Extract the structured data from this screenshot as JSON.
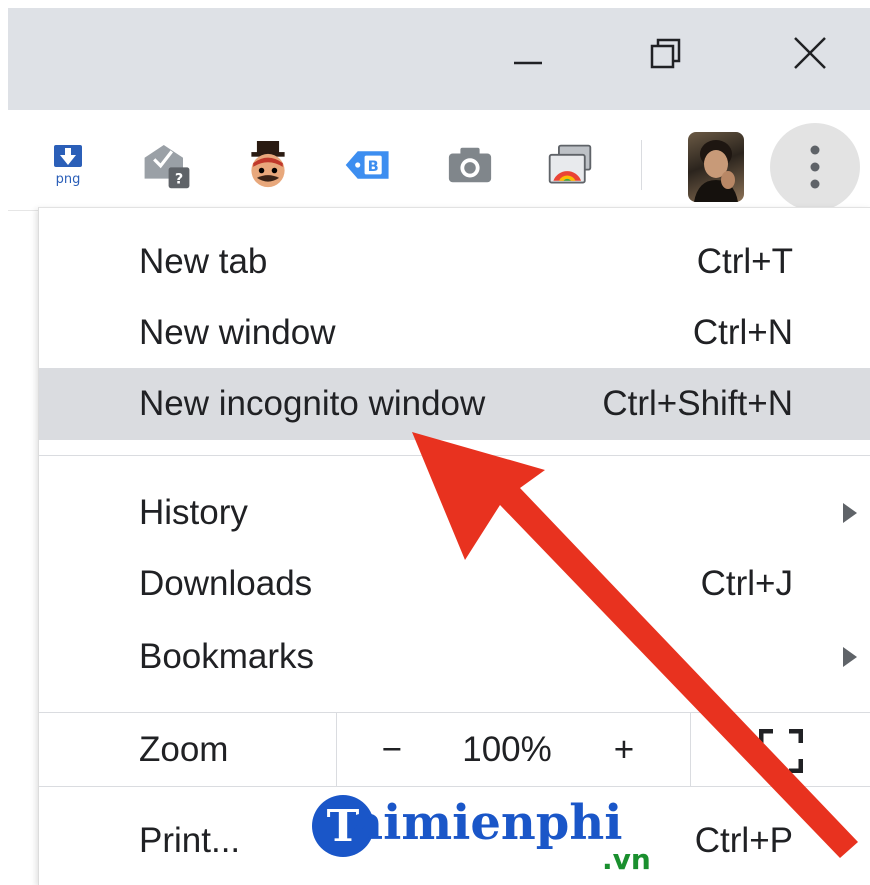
{
  "window_controls": {
    "minimize_icon": "minimize-icon",
    "restore_icon": "restore-icon",
    "close_icon": "close-icon"
  },
  "toolbar": {
    "extensions": [
      {
        "name": "download-png-extension-icon",
        "text": "png"
      },
      {
        "name": "mail-checker-extension-icon",
        "text": "?"
      },
      {
        "name": "character-extension-icon"
      },
      {
        "name": "tag-extension-icon",
        "text": "B"
      },
      {
        "name": "camera-extension-icon"
      },
      {
        "name": "chromecast-extension-icon"
      }
    ],
    "profile_avatar": "profile-avatar",
    "menu_icon": "more-vert-icon"
  },
  "menu": {
    "items": [
      {
        "label": "New tab",
        "shortcut": "Ctrl+T"
      },
      {
        "label": "New window",
        "shortcut": "Ctrl+N"
      },
      {
        "label": "New incognito window",
        "shortcut": "Ctrl+Shift+N",
        "highlighted": true
      },
      {
        "label": "History",
        "shortcut": "",
        "submenu": true
      },
      {
        "label": "Downloads",
        "shortcut": "Ctrl+J"
      },
      {
        "label": "Bookmarks",
        "shortcut": "",
        "submenu": true
      }
    ],
    "zoom": {
      "label": "Zoom",
      "minus": "−",
      "value": "100%",
      "plus": "+",
      "fullscreen_icon": "fullscreen-icon"
    },
    "print": {
      "label": "Print...",
      "shortcut": "Ctrl+P"
    }
  },
  "watermark": {
    "initial": "T",
    "brand": "aimienphi",
    "suffix": ".vn"
  },
  "colors": {
    "titlebar": "#dee1e6",
    "highlight": "#dadce0",
    "arrow": "#e8321f",
    "brand_blue": "#1a56c8",
    "brand_green": "#1a8f2e"
  }
}
